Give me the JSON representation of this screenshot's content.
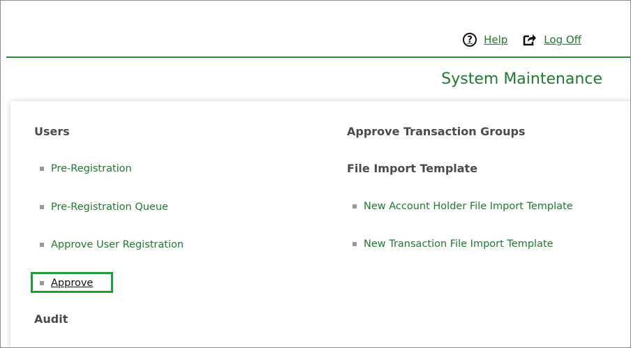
{
  "header": {
    "help_label": "Help",
    "logoff_label": "Log Off",
    "help_icon": "help-circle-icon",
    "logoff_icon": "log-off-icon"
  },
  "page_title": "System Maintenance",
  "left_column": {
    "users_heading": "Users",
    "items": [
      {
        "label": "Pre-Registration"
      },
      {
        "label": "Pre-Registration Queue"
      },
      {
        "label": "Approve User Registration"
      },
      {
        "label": "Approve"
      }
    ],
    "audit_heading": "Audit"
  },
  "right_column": {
    "approve_groups_heading": "Approve Transaction Groups",
    "file_import_heading": "File Import Template",
    "items": [
      {
        "label": "New Account Holder File Import Template"
      },
      {
        "label": "New Transaction File Import Template"
      }
    ]
  },
  "colors": {
    "accent_green": "#1f7a2e",
    "highlight_green": "#1aa238",
    "heading_gray": "#4a4a4a"
  }
}
